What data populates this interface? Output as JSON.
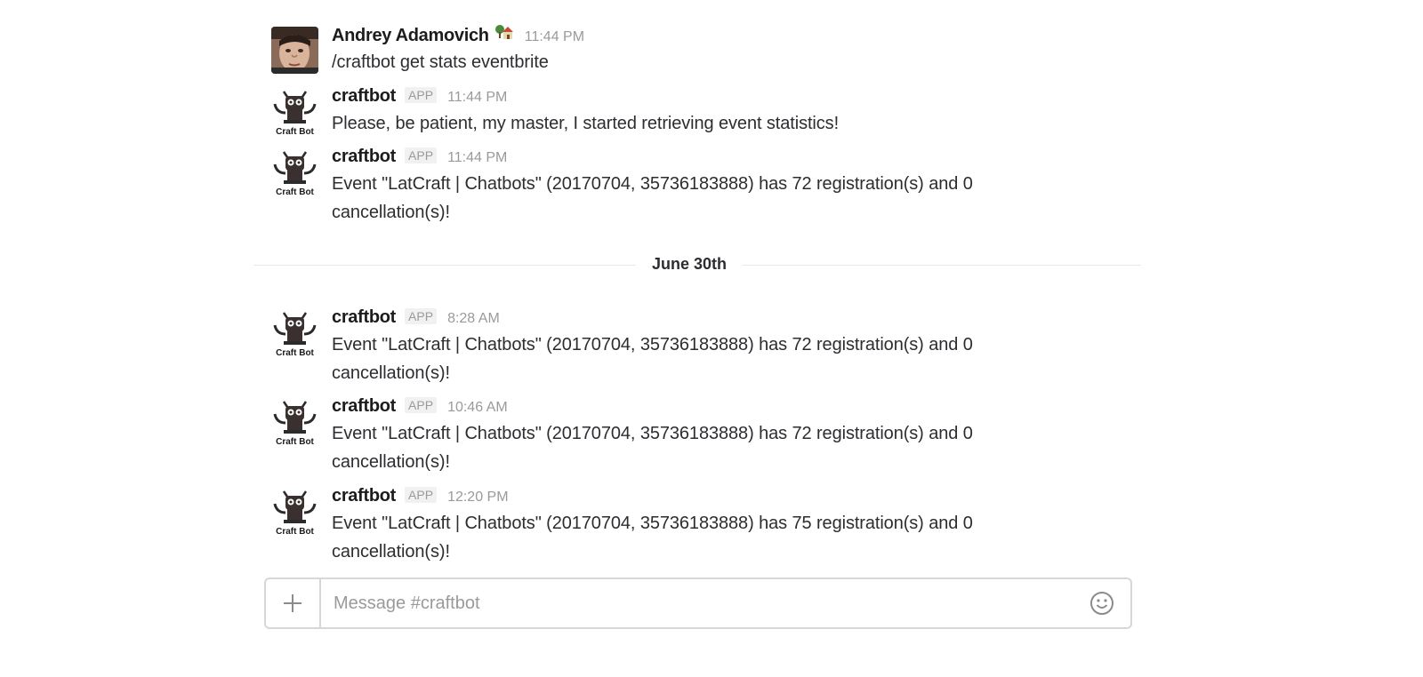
{
  "messages": [
    {
      "sender": "Andrey Adamovich",
      "time": "11:44 PM",
      "text": "/craftbot get stats eventbrite"
    },
    {
      "sender": "craftbot",
      "badge": "APP",
      "time": "11:44 PM",
      "text": "Please, be patient, my master, I started retrieving event statistics!"
    },
    {
      "sender": "craftbot",
      "badge": "APP",
      "time": "11:44 PM",
      "text": "Event \"LatCraft | Chatbots\" (20170704, 35736183888) has 72 registration(s) and 0 cancellation(s)!"
    },
    {
      "sender": "craftbot",
      "badge": "APP",
      "time": "8:28 AM",
      "text": "Event \"LatCraft | Chatbots\" (20170704, 35736183888) has 72 registration(s) and 0 cancellation(s)!"
    },
    {
      "sender": "craftbot",
      "badge": "APP",
      "time": "10:46 AM",
      "text": "Event \"LatCraft | Chatbots\" (20170704, 35736183888) has 72 registration(s) and 0 cancellation(s)!"
    },
    {
      "sender": "craftbot",
      "badge": "APP",
      "time": "12:20 PM",
      "text": "Event \"LatCraft | Chatbots\" (20170704, 35736183888) has 75 registration(s) and 0 cancellation(s)!"
    }
  ],
  "bot_avatar_label": "Craft Bot",
  "status_emoji": "house-with-garden-icon",
  "date_divider": "June 30th",
  "composer": {
    "placeholder": "Message #craftbot",
    "plus_label": "+",
    "emoji_icon": "smiley-icon"
  }
}
